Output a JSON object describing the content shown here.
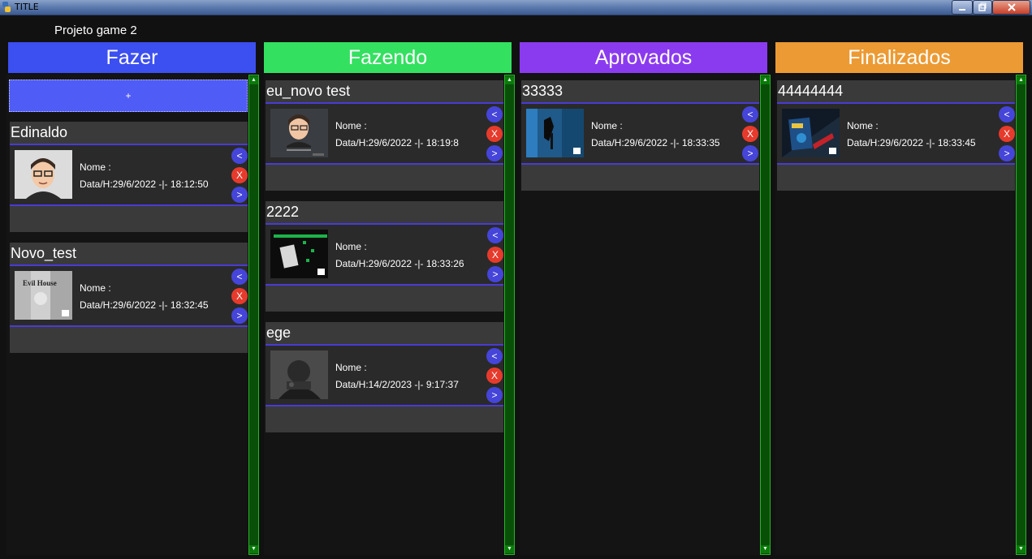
{
  "window": {
    "title": "TITLE"
  },
  "project": {
    "name": "Projeto  game 2"
  },
  "columns": [
    {
      "title": "Fazer",
      "color": "#3c4ff0"
    },
    {
      "title": "Fazendo",
      "color": "#33e060"
    },
    {
      "title": "Aprovados",
      "color": "#8b3bef"
    },
    {
      "title": "Finalizados",
      "color": "#ec9a33"
    }
  ],
  "add_button": {
    "label": "+"
  },
  "card_buttons": {
    "left": "<",
    "delete": "X",
    "right": ">"
  },
  "cards": {
    "fazer": [
      {
        "title": "Edinaldo",
        "nome": "Nome :",
        "data": "Data/H:29/6/2022 -|- 18:12:50",
        "thumb_icon": "avatar-thumbnail"
      },
      {
        "title": "Novo_test",
        "nome": "Nome :",
        "data": "Data/H:29/6/2022 -|- 18:32:45",
        "thumb_icon": "game-thumbnail",
        "thumb_text": "Evil House"
      }
    ],
    "fazendo": [
      {
        "title": "eu_novo test",
        "nome": "Nome :",
        "data": "Data/H:29/6/2022 -|- 18:19:8",
        "thumb_icon": "avatar-thumbnail"
      },
      {
        "title": "2222",
        "nome": "Nome :",
        "data": "Data/H:29/6/2022 -|- 18:33:26",
        "thumb_icon": "game-thumbnail"
      },
      {
        "title": "ege",
        "nome": "Nome :",
        "data": "Data/H:14/2/2023 -|- 9:17:37",
        "thumb_icon": "game-thumbnail"
      }
    ],
    "aprovados": [
      {
        "title": "33333",
        "nome": "Nome :",
        "data": "Data/H:29/6/2022 -|- 18:33:35",
        "thumb_icon": "game-thumbnail"
      }
    ],
    "finalizados": [
      {
        "title": "44444444",
        "nome": "Nome :",
        "data": "Data/H:29/6/2022 -|- 18:33:45",
        "thumb_icon": "game-thumbnail"
      }
    ]
  }
}
